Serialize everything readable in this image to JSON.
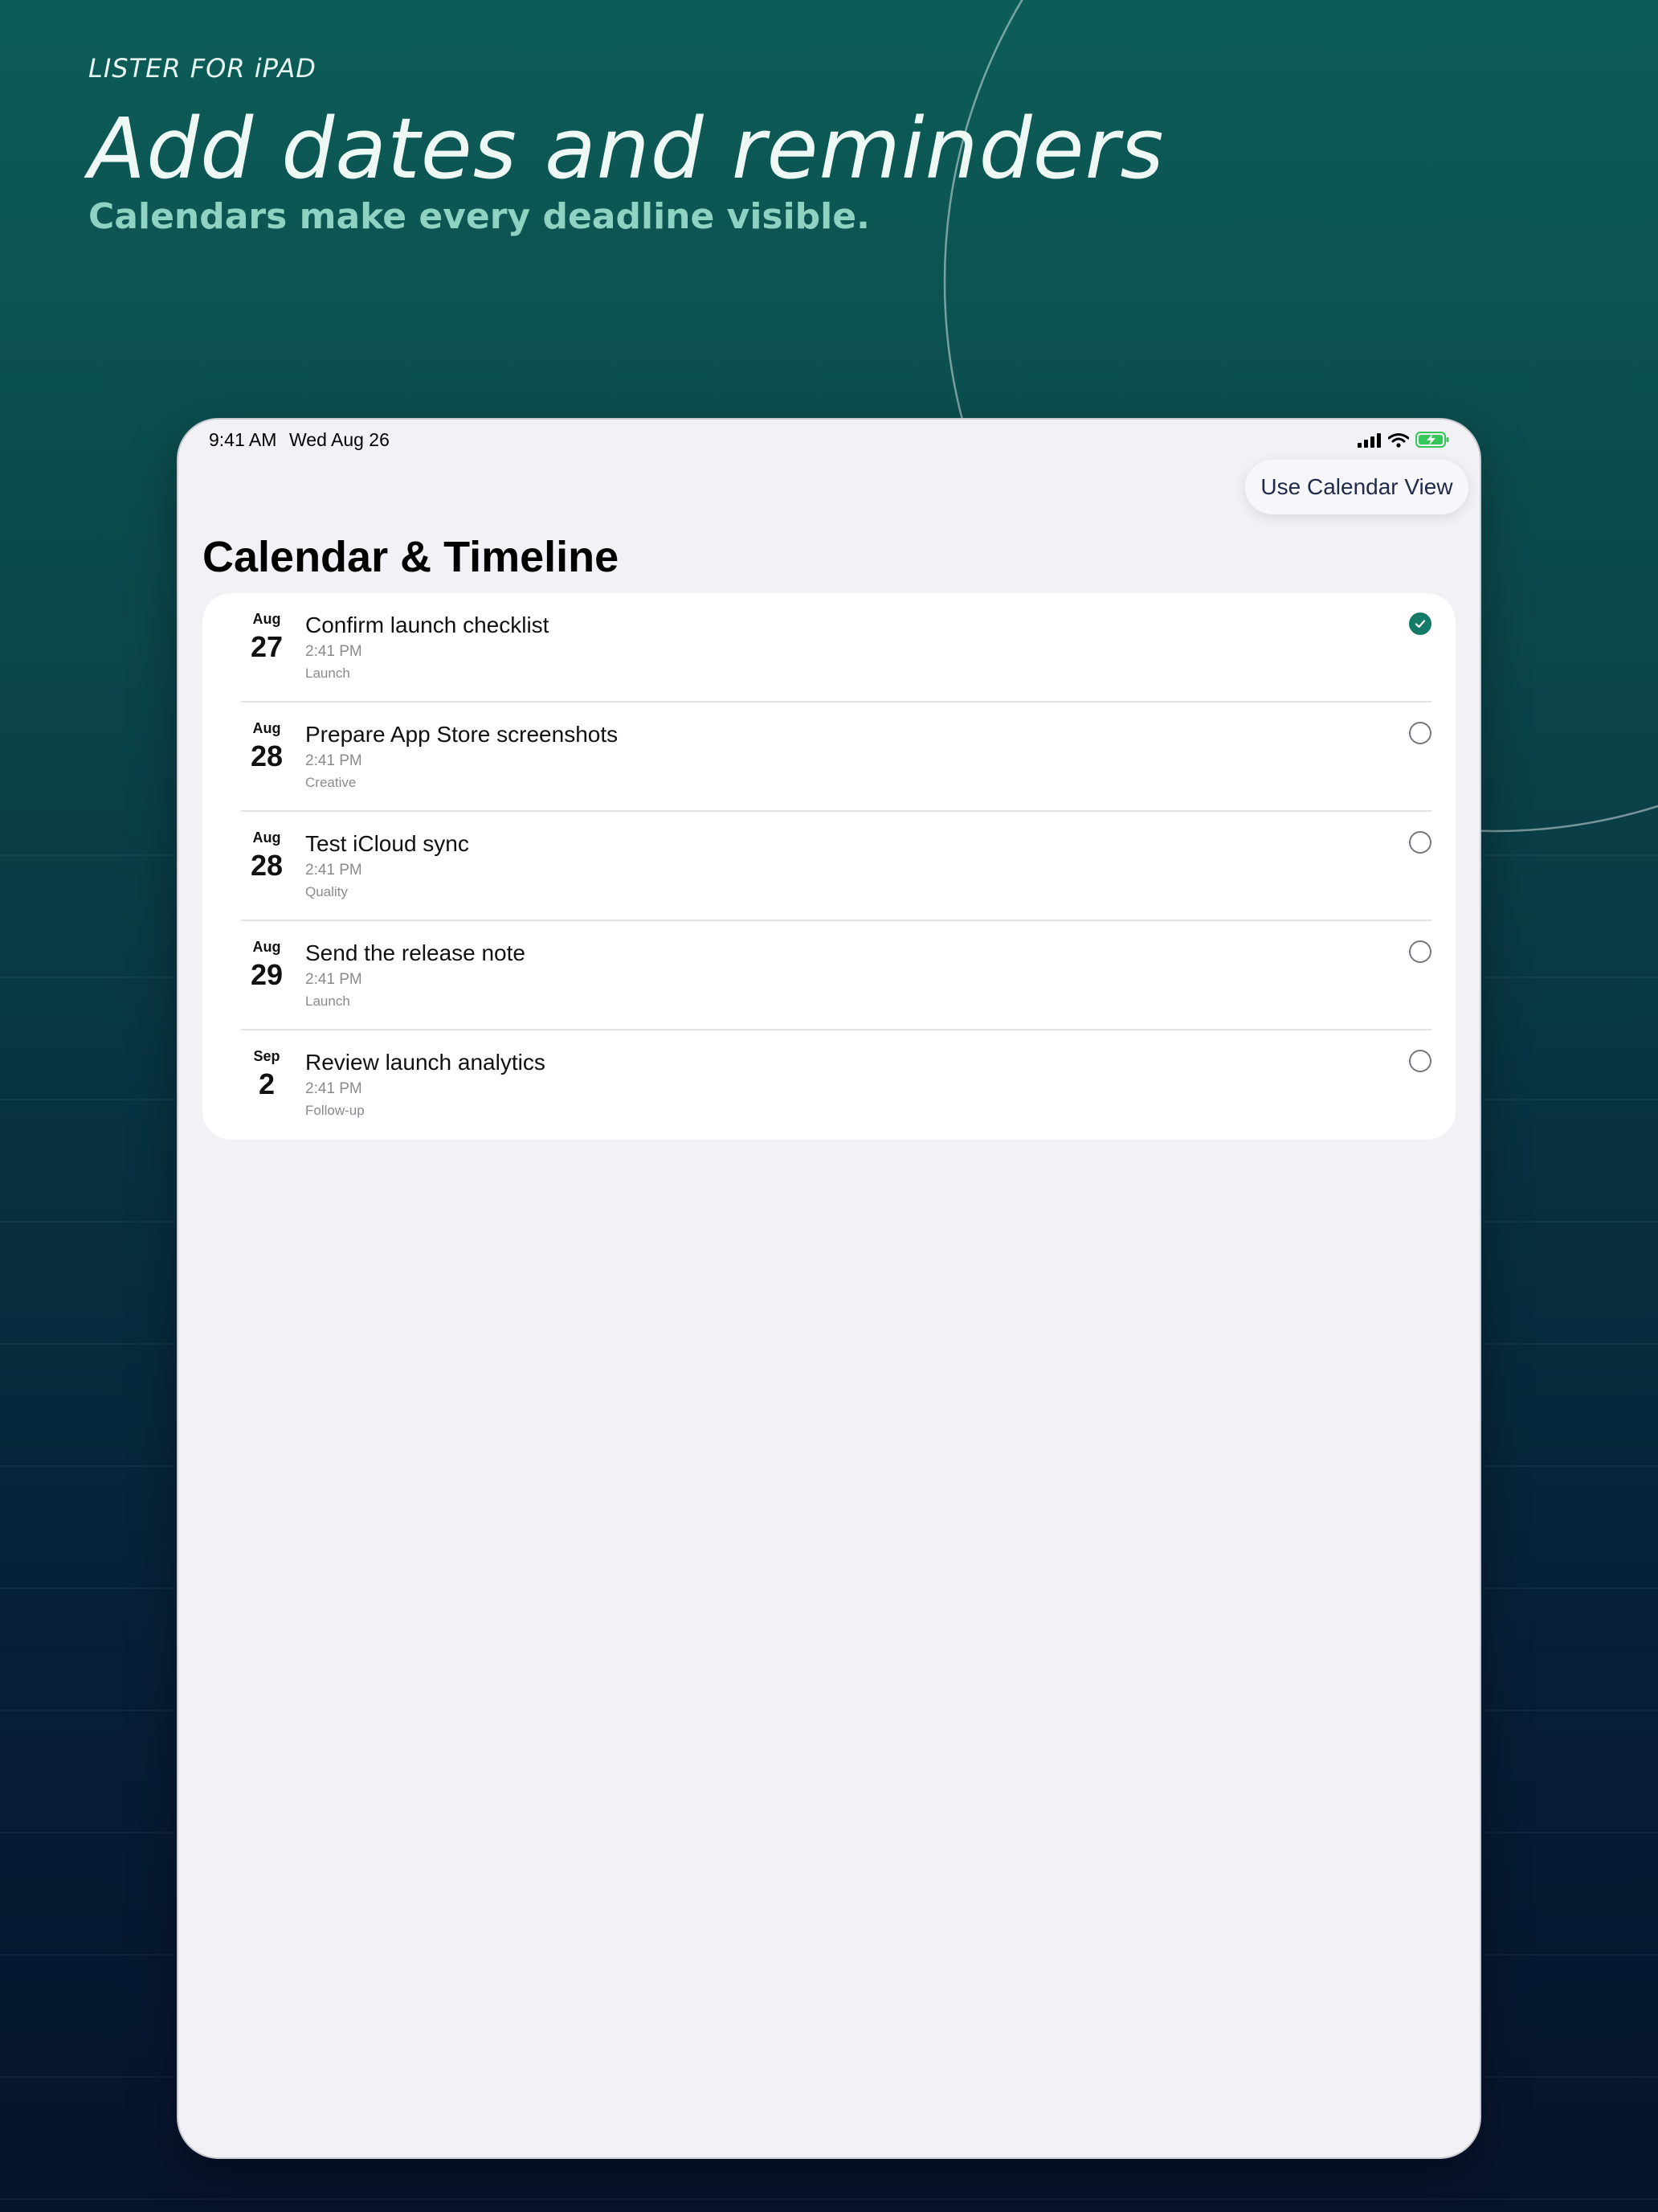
{
  "marketing": {
    "eyebrow": "LISTER FOR iPAD",
    "headline": "Add dates and reminders",
    "subhead": "Calendars make every deadline visible."
  },
  "status_bar": {
    "time": "9:41 AM",
    "date": "Wed Aug 26",
    "icons": [
      "cellular-signal-icon",
      "wifi-icon",
      "battery-charging-icon"
    ]
  },
  "toolbar": {
    "calendar_view_label": "Use Calendar View"
  },
  "page": {
    "title": "Calendar & Timeline"
  },
  "tasks": [
    {
      "month": "Aug",
      "day": "27",
      "title": "Confirm launch checklist",
      "time": "2:41 PM",
      "tag": "Launch",
      "done": true
    },
    {
      "month": "Aug",
      "day": "28",
      "title": "Prepare App Store screenshots",
      "time": "2:41 PM",
      "tag": "Creative",
      "done": false
    },
    {
      "month": "Aug",
      "day": "28",
      "title": "Test iCloud sync",
      "time": "2:41 PM",
      "tag": "Quality",
      "done": false
    },
    {
      "month": "Aug",
      "day": "29",
      "title": "Send the release note",
      "time": "2:41 PM",
      "tag": "Launch",
      "done": false
    },
    {
      "month": "Sep",
      "day": "2",
      "title": "Review launch analytics",
      "time": "2:41 PM",
      "tag": "Follow-up",
      "done": false
    }
  ],
  "colors": {
    "accent": "#137b67",
    "background_top": "#0c5d58",
    "background_bottom": "#06132c",
    "subhead": "#8ed3c1",
    "battery": "#34c759"
  }
}
